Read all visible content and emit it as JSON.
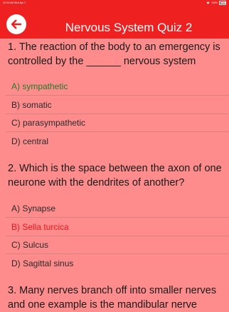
{
  "status": {
    "time": "10:29 AM",
    "date": "Wed Apr 2",
    "wifi_icon": "wifi-icon",
    "battery": "100%"
  },
  "header": {
    "title": "Nervous System Quiz 2",
    "back_icon": "arrow-left-icon"
  },
  "colors": {
    "header": "#ef2020",
    "background": "#ff8c8c",
    "correct": "#1f7a2a",
    "wrong": "#e8191c"
  },
  "questions": [
    {
      "text": "1. The reaction of the body to an emergency is controlled by the ______ nervous system",
      "options": [
        "A) sympathetic",
        "B) somatic",
        "C) parasympathetic",
        "D) central"
      ],
      "correct_index": 0,
      "selected_index": 0
    },
    {
      "text": "2. Which is the space between the axon of one neurone with the dendrites of another?",
      "options": [
        "A) Synapse",
        "B) Sella turcica",
        "C) Sulcus",
        "D) Sagittal sinus"
      ],
      "correct_index": 0,
      "selected_index": 1
    },
    {
      "text": "3. Many nerves branch off into smaller nerves and one example is the mandibular nerve"
    }
  ]
}
